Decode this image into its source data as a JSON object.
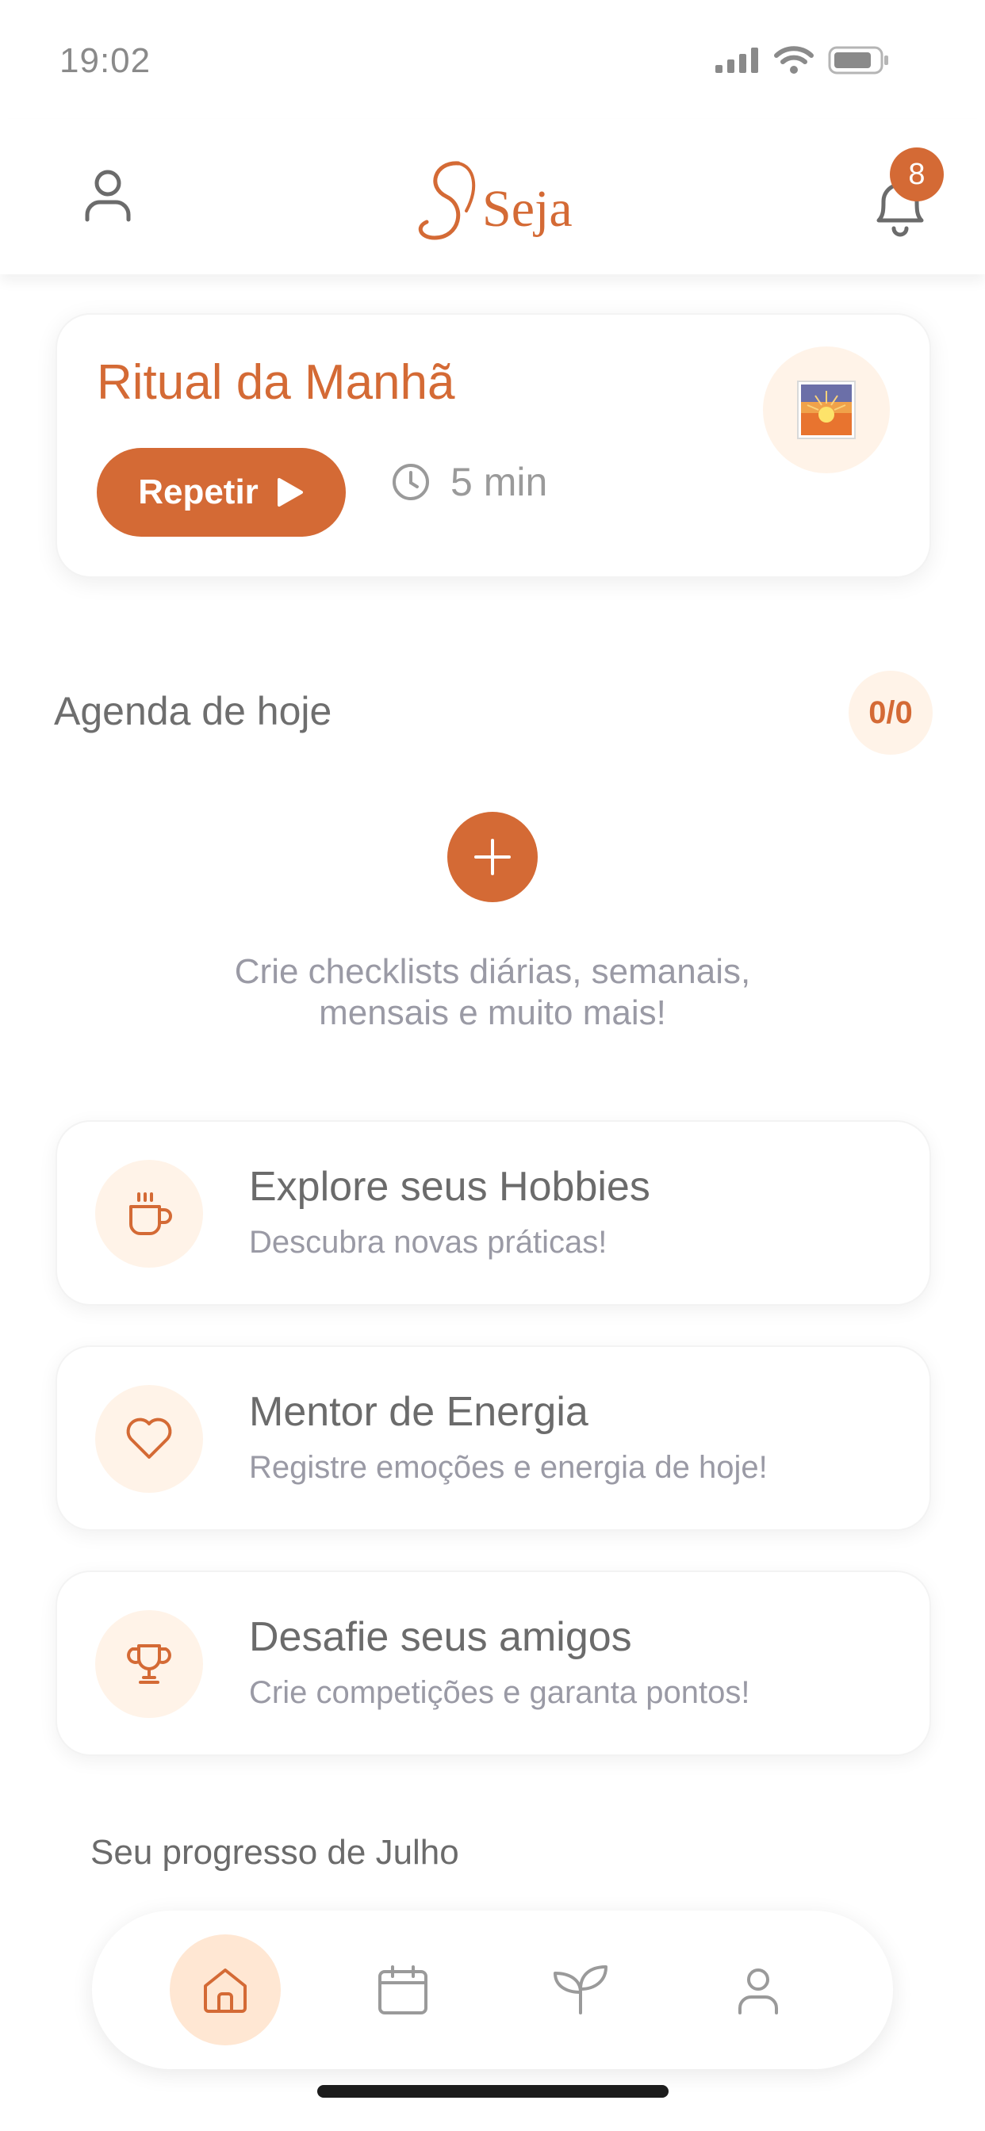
{
  "status_bar": {
    "time": "19:02"
  },
  "header": {
    "logo_text": "Seja",
    "notification_count": "8"
  },
  "ritual": {
    "title": "Ritual da Manhã",
    "button_label": "Repetir",
    "duration": "5 min",
    "thumbnail_icon": "sunrise-icon"
  },
  "agenda": {
    "title": "Agenda de hoje",
    "count": "0/0",
    "empty_message_line1": "Crie checklists diárias, semanais,",
    "empty_message_line2": "mensais e muito mais!"
  },
  "features": [
    {
      "title": "Explore seus Hobbies",
      "subtitle": "Descubra novas práticas!",
      "icon": "coffee-cup-icon"
    },
    {
      "title": "Mentor de Energia",
      "subtitle": "Registre emoções e energia de hoje!",
      "icon": "heart-icon"
    },
    {
      "title": "Desafie seus amigos",
      "subtitle": "Crie competições e garanta pontos!",
      "icon": "trophy-icon"
    }
  ],
  "progress": {
    "title": "Seu progresso de Julho"
  },
  "bottom_nav": {
    "items": [
      {
        "icon": "home-icon",
        "active": true
      },
      {
        "icon": "calendar-icon",
        "active": false
      },
      {
        "icon": "plant-icon",
        "active": false
      },
      {
        "icon": "profile-icon",
        "active": false
      }
    ]
  },
  "colors": {
    "accent": "#D46A35",
    "accent_soft": "#FFF3E8",
    "text": "#6b6b6b",
    "muted": "#9a9aa5"
  }
}
